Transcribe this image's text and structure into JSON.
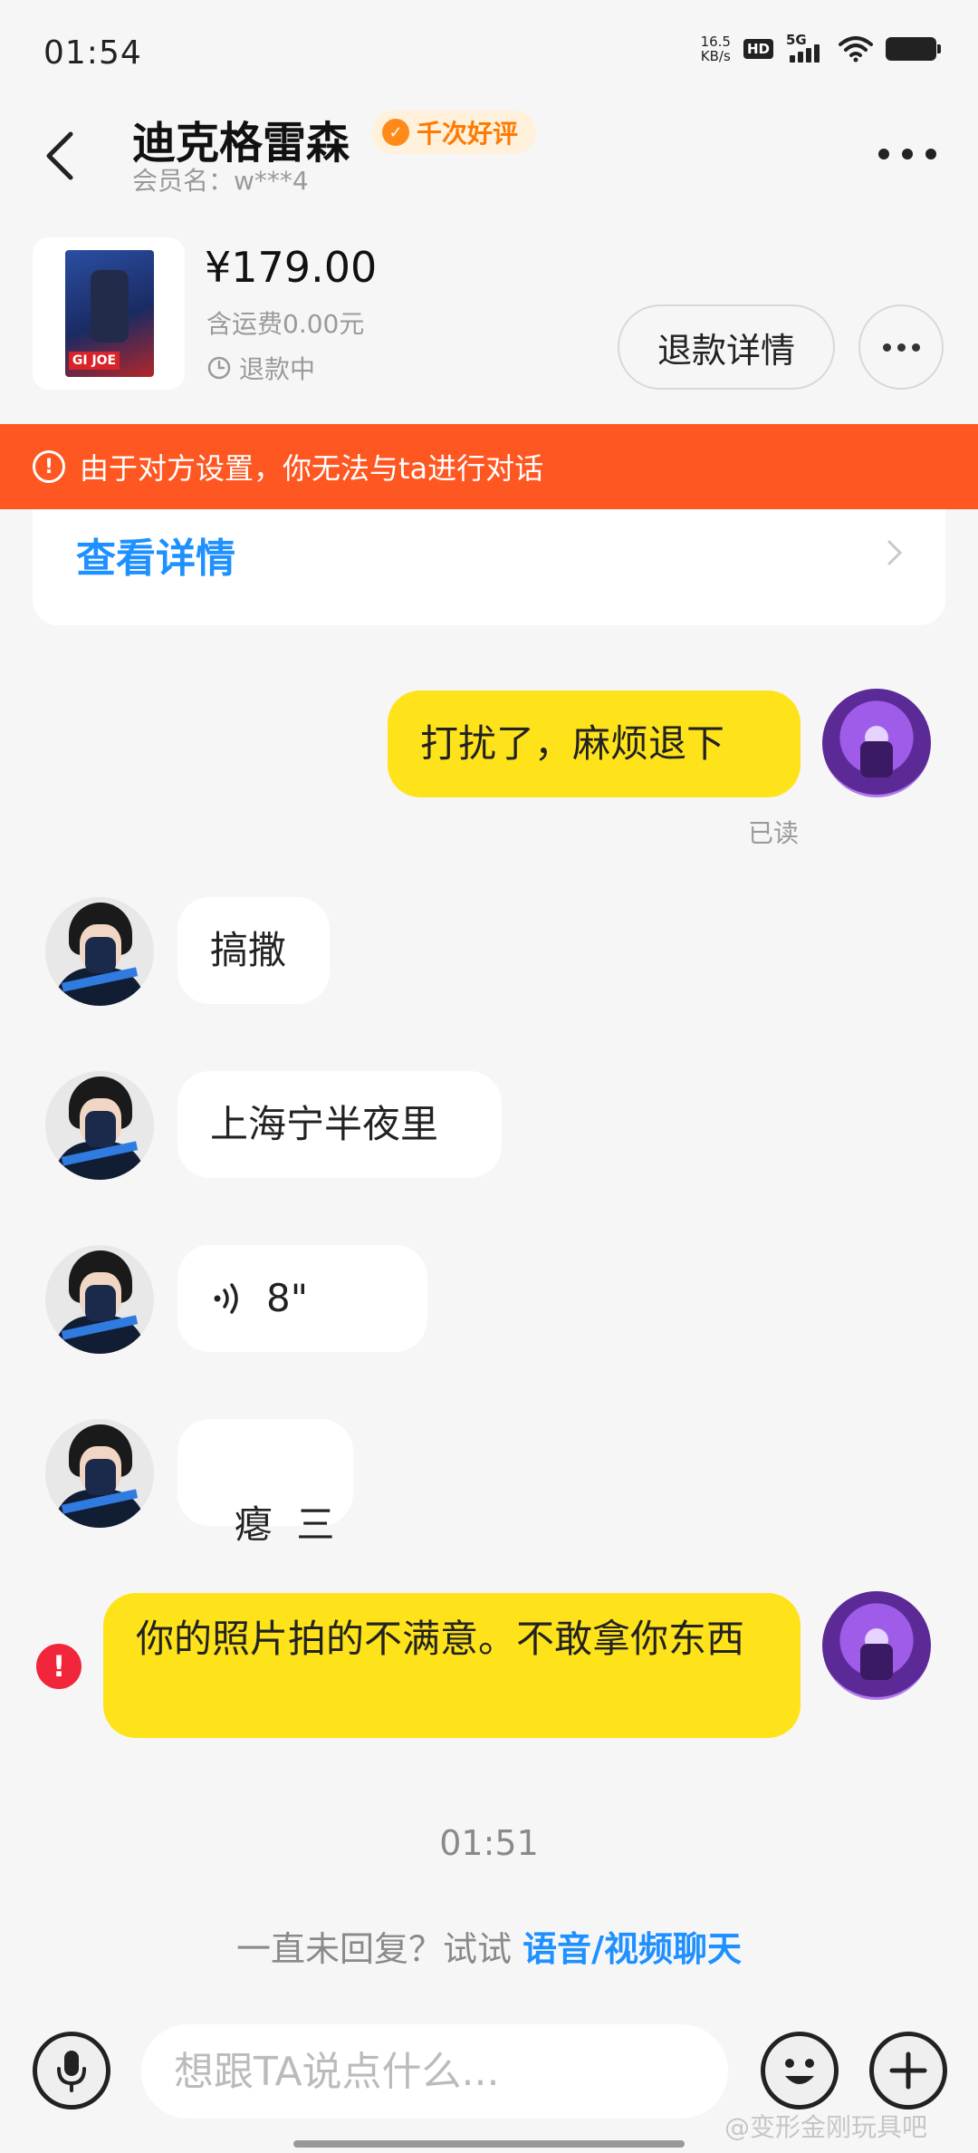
{
  "status_bar": {
    "time": "01:54",
    "net_speed": "16.5",
    "net_unit": "KB/s",
    "hd": "HD",
    "network": "5G"
  },
  "header": {
    "title": "迪克格雷森",
    "badge": "千次好评",
    "member": "会员名：w***4"
  },
  "product": {
    "price": "¥179.00",
    "shipping": "含运费0.00元",
    "status": "退款中",
    "refund_button": "退款详情",
    "thumb_logo": "GI JOE"
  },
  "warning": {
    "text": "由于对方设置，你无法与ta进行对话"
  },
  "details": {
    "link": "查看详情"
  },
  "messages": [
    {
      "side": "out",
      "text": "打扰了，麻烦退下",
      "status": "已读"
    },
    {
      "side": "in",
      "text": "搞撒"
    },
    {
      "side": "in",
      "text": "上海宁半夜里"
    },
    {
      "side": "in",
      "type": "voice",
      "duration": "8\""
    },
    {
      "side": "in",
      "text": "瘪  三"
    },
    {
      "side": "out",
      "text": "你的照片拍的不满意。不敢拿你东西",
      "failed": true
    }
  ],
  "timestamp": "01:51",
  "suggest": {
    "text": "一直未回复？试试",
    "link": "语音/视频聊天"
  },
  "input": {
    "placeholder": "想跟TA说点什么..."
  },
  "watermark": "@变形金刚玩具吧",
  "colors": {
    "warning": "#ff5722",
    "bubble_out": "#ffe31a",
    "link": "#1e90ff",
    "badge_text": "#ff7a00",
    "error": "#f2263b"
  }
}
